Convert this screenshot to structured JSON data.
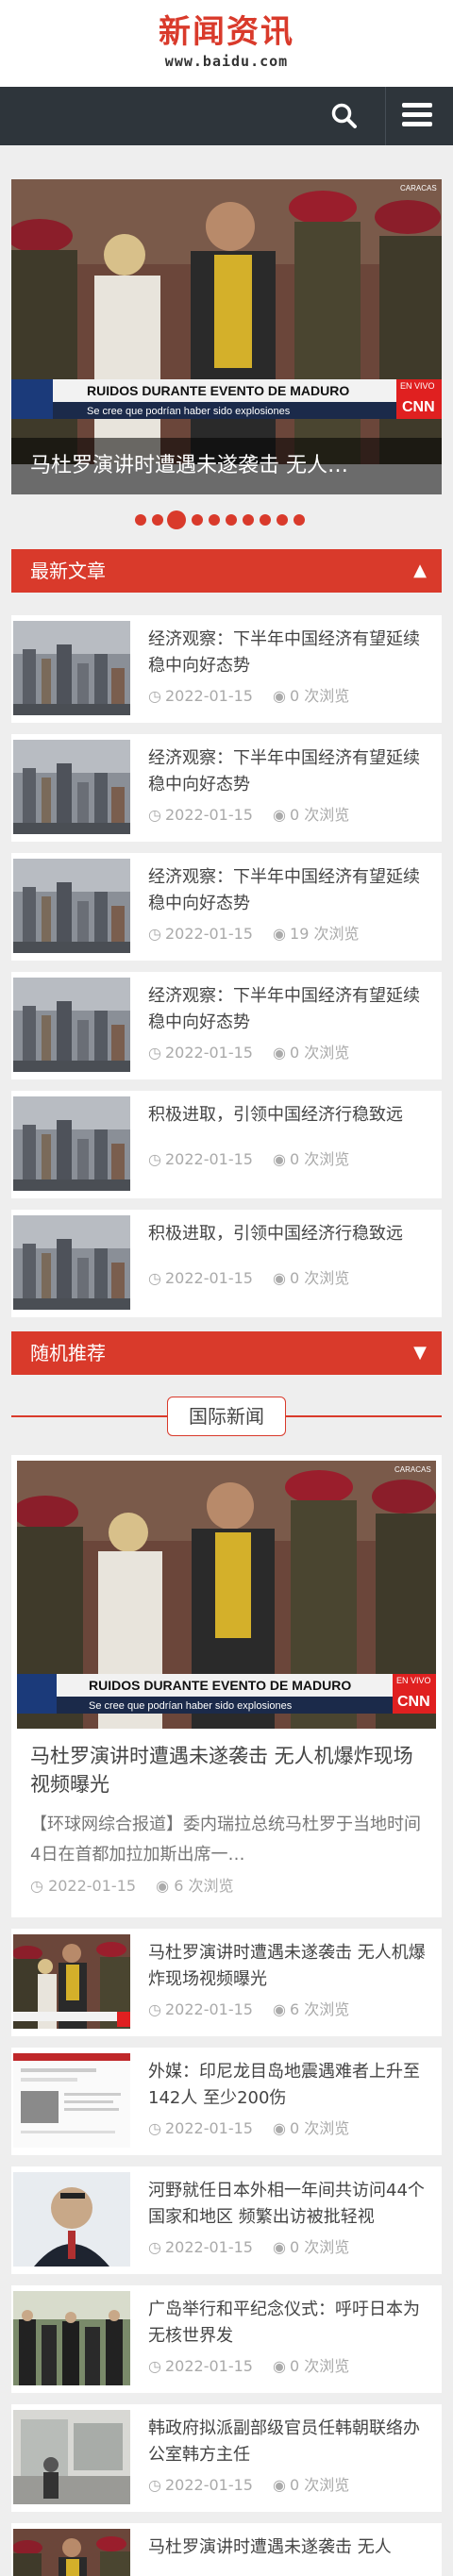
{
  "header": {
    "logo_title": "新闻资讯",
    "logo_url": "www.baidu.com"
  },
  "navbar": {
    "search_icon": "search-icon",
    "menu_icon": "hamburger-menu-icon"
  },
  "slider": {
    "caption": "马杜罗演讲时遭遇未遂袭击 无人…",
    "dots_count": 10,
    "active_dot": 3,
    "image_text": {
      "banner_line1": "RUIDOS DURANTE EVENTO DE MADURO",
      "banner_line2": "Se cree que podrían haber sido explosiones",
      "live": "EN VIVO",
      "network": "CNN",
      "top_right": "CARACAS"
    }
  },
  "latest": {
    "title": "最新文章",
    "toggle_icon": "triangle-up-icon",
    "items": [
      {
        "title": "经济观察：下半年中国经济有望延续稳中向好态势",
        "date": "2022-01-15",
        "views": "0 次浏览"
      },
      {
        "title": "经济观察：下半年中国经济有望延续稳中向好态势",
        "date": "2022-01-15",
        "views": "0 次浏览"
      },
      {
        "title": "经济观察：下半年中国经济有望延续稳中向好态势",
        "date": "2022-01-15",
        "views": "19 次浏览"
      },
      {
        "title": "经济观察：下半年中国经济有望延续稳中向好态势",
        "date": "2022-01-15",
        "views": "0 次浏览"
      },
      {
        "title": "积极进取，引领中国经济行稳致远",
        "date": "2022-01-15",
        "views": "0 次浏览"
      },
      {
        "title": "积极进取，引领中国经济行稳致远",
        "date": "2022-01-15",
        "views": "0 次浏览"
      }
    ]
  },
  "random": {
    "title": "随机推荐",
    "toggle_icon": "triangle-down-icon"
  },
  "international": {
    "tag": "国际新闻",
    "feature": {
      "title": "马杜罗演讲时遭遇未遂袭击 无人机爆炸现场视频曝光",
      "summary": "【环球网综合报道】委内瑞拉总统马杜罗于当地时间4日在首都加拉加斯出席一…",
      "date": "2022-01-15",
      "views": "6 次浏览"
    },
    "items": [
      {
        "title": "马杜罗演讲时遭遇未遂袭击 无人机爆炸现场视频曝光",
        "date": "2022-01-15",
        "views": "6 次浏览"
      },
      {
        "title": "外媒：印尼龙目岛地震遇难者上升至142人 至少200伤",
        "date": "2022-01-15",
        "views": "0 次浏览"
      },
      {
        "title": "河野就任日本外相一年间共访问44个国家和地区 频繁出访被批轻视",
        "date": "2022-01-15",
        "views": "0 次浏览"
      },
      {
        "title": "广岛举行和平纪念仪式：呼吁日本为无核世界发",
        "date": "2022-01-15",
        "views": "0 次浏览"
      },
      {
        "title": "韩政府拟派副部级官员任韩朝联络办公室韩方主任",
        "date": "2022-01-15",
        "views": "0 次浏览"
      },
      {
        "title": "马杜罗演讲时遭遇未遂袭击 无人",
        "date": "",
        "views": ""
      }
    ]
  },
  "icons": {
    "clock": "clock-icon",
    "eye": "eye-icon"
  },
  "colors": {
    "brand_red": "#d93a2b",
    "navbar": "#2e353b",
    "background": "#eeeeee",
    "meta_gray": "#aaaaaa"
  }
}
